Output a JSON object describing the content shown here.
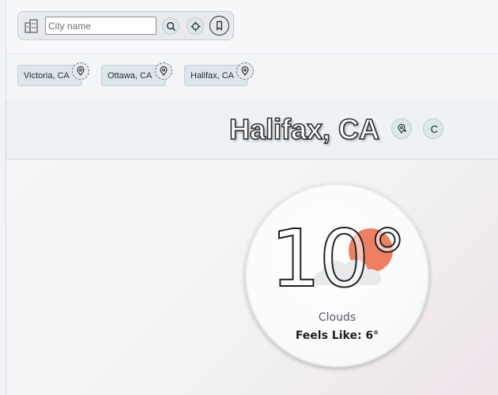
{
  "search": {
    "placeholder": "City name",
    "value": ""
  },
  "icons": {
    "city": "city-building-icon",
    "search": "search-icon",
    "locate": "crosshair-locate-icon",
    "bookmark": "bookmark-icon",
    "pin": "pin-add-icon",
    "thermometer": "thermometer-icon",
    "weather": "sun-behind-cloud-icon"
  },
  "favorites": [
    {
      "label": "Victoria, CA"
    },
    {
      "label": "Ottawa, CA"
    },
    {
      "label": "Halifax, CA"
    }
  ],
  "header": {
    "city": "Halifax, CA",
    "unit_label": "C"
  },
  "weather": {
    "temperature": "10°",
    "condition": "Clouds",
    "feels_like": "Feels Like: 6°"
  },
  "colors": {
    "sun": "#ef7f62",
    "cloud": "#e9eaec",
    "chip_bg": "#dde7eb",
    "button_bg": "#dce8ec"
  }
}
